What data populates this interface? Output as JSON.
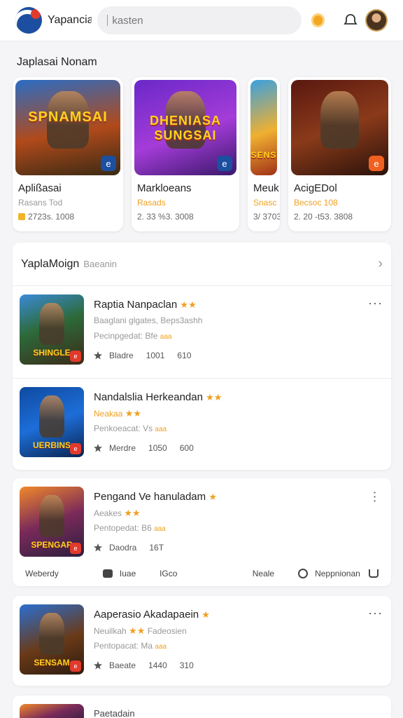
{
  "header": {
    "app_name": "Yapancia",
    "search_placeholder": "kasten"
  },
  "featured": {
    "title": "Japlasai Nonam",
    "cards": [
      {
        "name": "Aplißasai",
        "tag": "Rasans Tod",
        "meta": "2723s. 1008",
        "art_text": "SPNAMSAI",
        "tag_color": "gray"
      },
      {
        "name": "Markloeans",
        "tag": "Rasads",
        "meta": "2. 33 %3. 3008",
        "art_text": "DHENIASA SUNGSAI",
        "tag_color": "orange"
      },
      {
        "name": "Meuk",
        "tag": "Snasc",
        "meta": "3/ 3703",
        "art_text": "SENS",
        "tag_color": "orange"
      },
      {
        "name": "AcigEDol",
        "tag": "Becsoc 108",
        "meta": "2. 20 -t53. 3808",
        "art_text": "",
        "tag_color": "orange"
      }
    ]
  },
  "list": {
    "title": "YaplaMoign",
    "subtitle": "Baeanin",
    "items": [
      {
        "title": "Raptia Nanpaclan",
        "stars": "★★",
        "line2": "Baaglani glgates, Beps3ashh",
        "line3": "Pecinpgedat:",
        "line3_tag": "Bfe",
        "line3_orange": "aaa",
        "stat1": "Bladre",
        "stat2": "1001",
        "stat3": "610",
        "art_text": "SHINGLE"
      },
      {
        "title": "Nandalslia Herkeandan",
        "stars": "★★",
        "line2": "Neakaa",
        "line2_stars": "★★",
        "line3": "Penkoeacat:",
        "line3_tag": "Vs",
        "line3_orange": "aaa",
        "stat1": "Merdre",
        "stat2": "1050",
        "stat3": "600",
        "art_text": "UERBINS"
      }
    ]
  },
  "cards": [
    {
      "title": "Pengand Ve hanuladam",
      "stars": "★",
      "line2": "Aeakes",
      "line2_stars": "★★",
      "line3": "Pentopedat:",
      "line3_tag": "B6",
      "line3_orange": "aaa",
      "stat1": "Daodra",
      "stat2": "16T",
      "stat3": "",
      "art_text": "SPENGAR",
      "actions": {
        "a1": "Weberdy",
        "a2": "Iuae",
        "a3": "IGco",
        "a4": "Neale",
        "a5": "Neppnionan"
      }
    },
    {
      "title": "Aaperasio Akadapaein",
      "stars": "★",
      "line2": "Neuilkah",
      "line2_stars": "★★",
      "line2_tail": "Fadeosien",
      "line3": "Pentopacat:",
      "line3_tag": "Ma",
      "line3_orange": "aaa",
      "stat1": "Baeate",
      "stat2": "1440",
      "stat3": "310",
      "art_text": "SENSAM"
    }
  ],
  "partial": {
    "title": "Paetadain"
  },
  "colors": {
    "accent": "#f0a020",
    "brand": "#1c4fa0",
    "badge_red": "#e23a2c"
  }
}
